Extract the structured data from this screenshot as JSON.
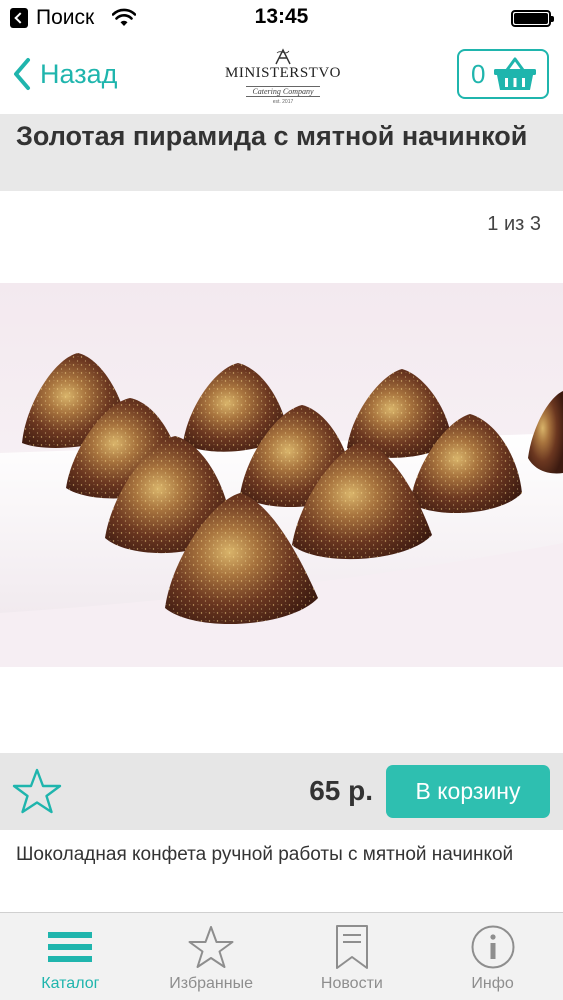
{
  "status_bar": {
    "carrier": "Поиск",
    "time": "13:45"
  },
  "nav": {
    "back_label": "Назад",
    "logo_title": "MINISTERSTVO",
    "logo_subtitle": "Catering Company",
    "logo_est": "est. 2017",
    "cart_count": "0"
  },
  "product": {
    "title": "Золотая пирамида с мятной начинкой",
    "image_counter": "1 из 3",
    "price": "65 р.",
    "add_to_cart_label": "В корзину",
    "description": "Шоколадная конфета ручной работы с мятной начинкой"
  },
  "tabs": [
    {
      "label": "Каталог",
      "icon": "menu-icon",
      "active": true
    },
    {
      "label": "Избранные",
      "icon": "star-icon",
      "active": false
    },
    {
      "label": "Новости",
      "icon": "bookmark-icon",
      "active": false
    },
    {
      "label": "Инфо",
      "icon": "info-icon",
      "active": false
    }
  ],
  "colors": {
    "accent": "#1fb5ad",
    "button": "#2ebfb0",
    "band": "#e8e8e8",
    "tab_inactive": "#8e8e8e"
  }
}
